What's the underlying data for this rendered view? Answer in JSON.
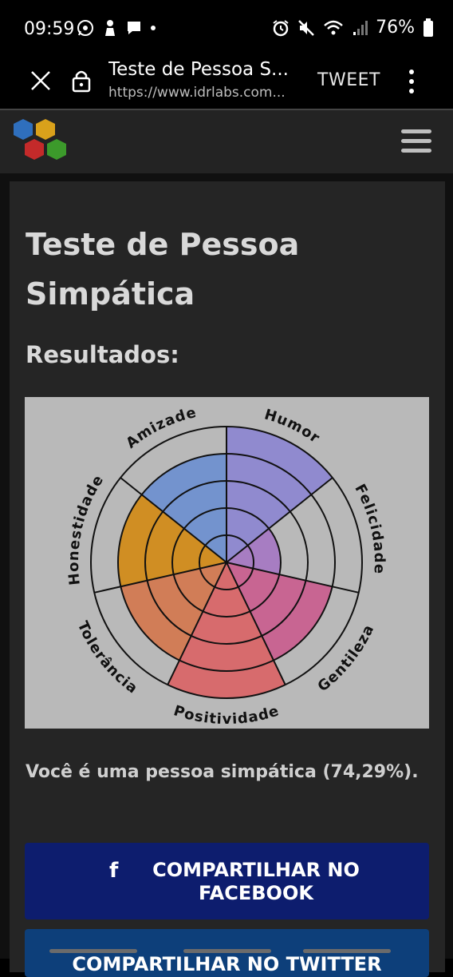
{
  "status_bar": {
    "time": "09:59",
    "battery": "76%",
    "left_icons": [
      "whatsapp-icon",
      "notification-icon",
      "chat-icon",
      "dot-icon"
    ],
    "right_icons": [
      "alarm-icon",
      "mute-icon",
      "wifi-icon",
      "signal-icon",
      "battery-icon"
    ]
  },
  "browser": {
    "title": "Teste de Pessoa S...",
    "url": "https://www.idrlabs.com...",
    "tweet_label": "TWEET"
  },
  "page": {
    "title": "Teste de Pessoa Simpática",
    "subtitle": "Resultados:",
    "result_text": "Você é uma pessoa simpática (74,29%).",
    "facebook_button": "COMPARTILHAR NO FACEBOOK",
    "twitter_button": "COMPARTILHAR NO TWITTER"
  },
  "chart_data": {
    "type": "polar-area",
    "categories": [
      "Humor",
      "Felicidade",
      "Gentileza",
      "Positividade",
      "Tolerância",
      "Honestidade",
      "Amizade"
    ],
    "values": [
      5,
      2,
      4,
      5,
      4,
      4,
      4
    ],
    "max": 5,
    "colors": [
      "#8c86d0",
      "#a577c2",
      "#c95d8e",
      "#d96466",
      "#d2774e",
      "#d18a16",
      "#6d8fcf"
    ],
    "background": "#b9b9b9"
  },
  "colors": {
    "facebook_blue": "#0d1d6e",
    "twitter_blue": "#0d3f7a",
    "card_bg": "#252525"
  }
}
